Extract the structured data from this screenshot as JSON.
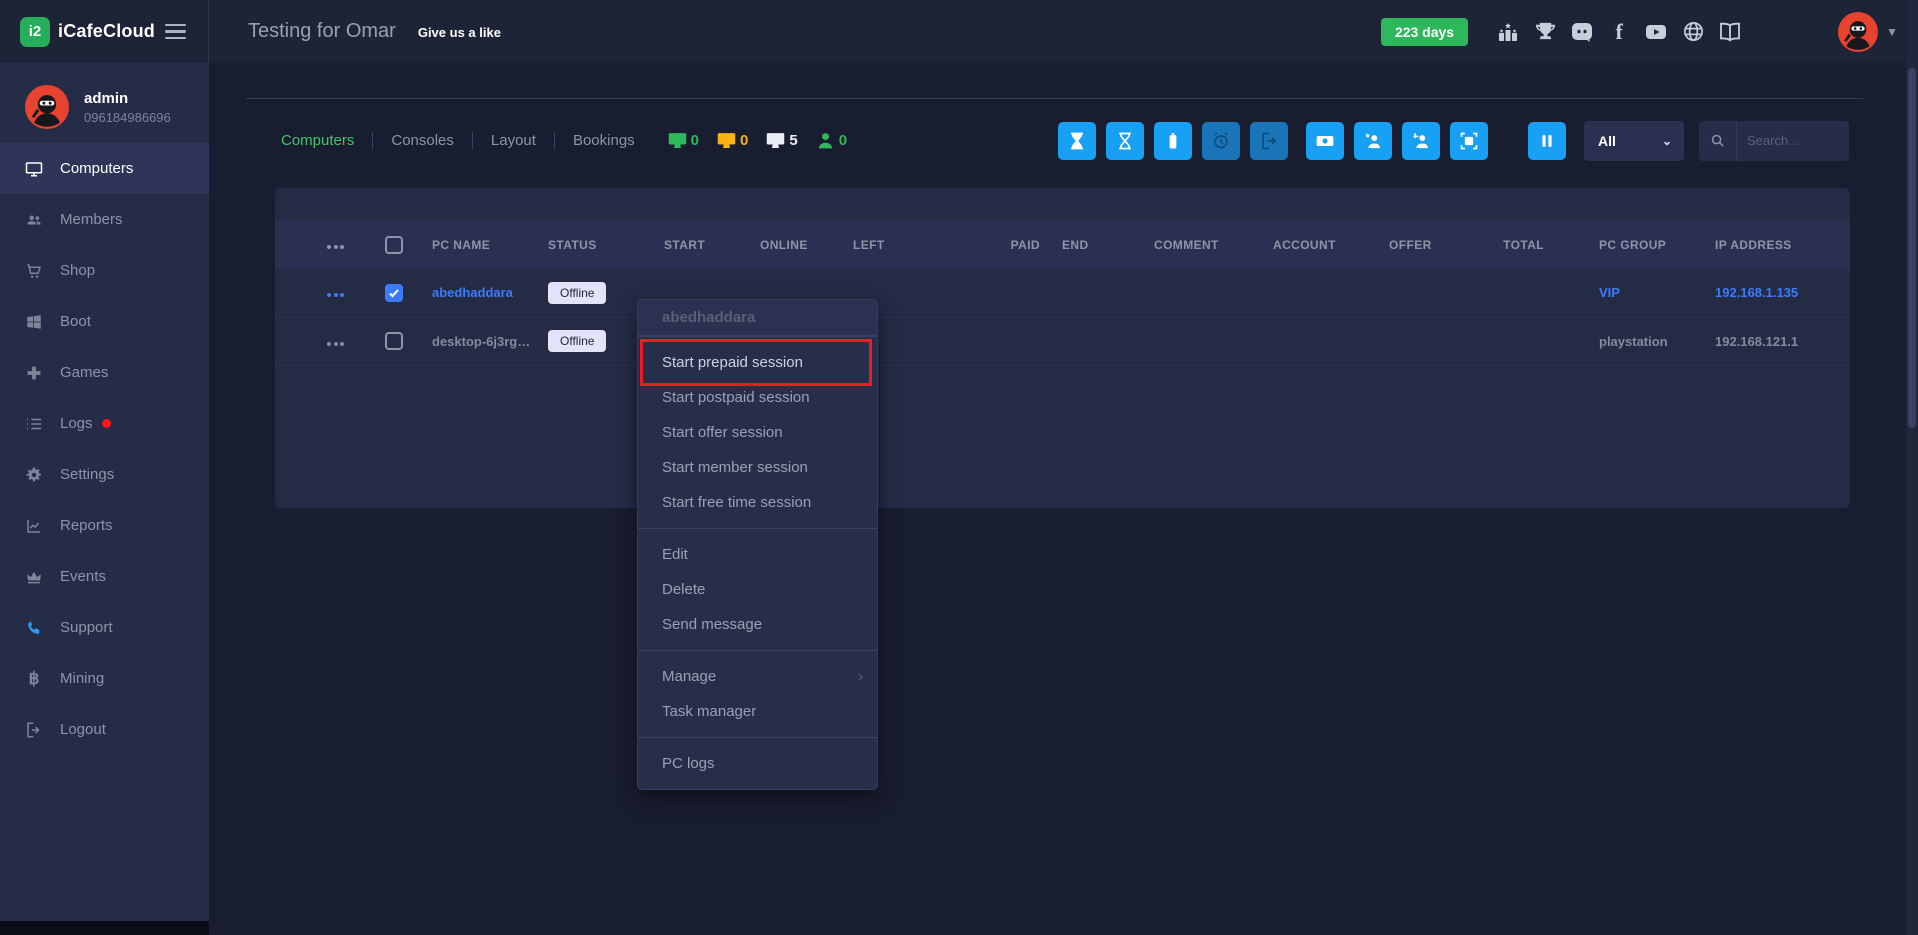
{
  "brand": {
    "name": "iCafeCloud"
  },
  "topbar": {
    "cafe_name": "Testing for Omar",
    "like_label": "Give us a like",
    "days_badge": "223 days"
  },
  "sidebar": {
    "user": {
      "name": "admin",
      "phone": "096184986696"
    },
    "items": [
      {
        "label": "Computers",
        "active": true
      },
      {
        "label": "Members"
      },
      {
        "label": "Shop"
      },
      {
        "label": "Boot"
      },
      {
        "label": "Games"
      },
      {
        "label": "Logs",
        "has_alert_dot": true
      },
      {
        "label": "Settings"
      },
      {
        "label": "Reports"
      },
      {
        "label": "Events"
      },
      {
        "label": "Support"
      },
      {
        "label": "Mining"
      },
      {
        "label": "Logout"
      }
    ]
  },
  "toolbar": {
    "tabs": [
      {
        "label": "Computers",
        "active": true
      },
      {
        "label": "Consoles",
        "active": false
      },
      {
        "label": "Layout",
        "active": false
      },
      {
        "label": "Bookings",
        "active": false
      }
    ],
    "counters": [
      {
        "name": "pcs-in-use",
        "value": "0",
        "color": "#2eb85c"
      },
      {
        "name": "pcs-warning",
        "value": "0",
        "color": "#f9b115"
      },
      {
        "name": "pcs-total",
        "value": "5",
        "color": "#e9edf5"
      },
      {
        "name": "members-online",
        "value": "0",
        "color": "#2eb85c"
      }
    ],
    "filter_value": "All",
    "search_placeholder": "Search..."
  },
  "table": {
    "columns": [
      "PC NAME",
      "STATUS",
      "START",
      "ONLINE",
      "LEFT",
      "PAID",
      "END",
      "COMMENT",
      "ACCOUNT",
      "OFFER",
      "TOTAL",
      "PC GROUP",
      "IP ADDRESS"
    ],
    "rows": [
      {
        "pc_name": "abedhaddara",
        "status": "Offline",
        "pc_group": "VIP",
        "ip_address": "192.168.1.135",
        "checked": true
      },
      {
        "pc_name": "desktop-6j3rg…",
        "status": "Offline",
        "pc_group": "playstation",
        "ip_address": "192.168.121.1",
        "checked": false
      }
    ]
  },
  "context_menu": {
    "title": "abedhaddara",
    "groups": [
      {
        "items": [
          {
            "label": "Start prepaid session",
            "highlighted": true
          },
          {
            "label": "Start postpaid session"
          },
          {
            "label": "Start offer session"
          },
          {
            "label": "Start member session"
          },
          {
            "label": "Start free time session"
          }
        ]
      },
      {
        "items": [
          {
            "label": "Edit"
          },
          {
            "label": "Delete"
          },
          {
            "label": "Send message"
          }
        ]
      },
      {
        "items": [
          {
            "label": "Manage",
            "has_submenu": true
          },
          {
            "label": "Task manager"
          }
        ]
      },
      {
        "items": [
          {
            "label": "PC logs"
          }
        ]
      }
    ]
  },
  "colors": {
    "green_accent": "#2eb85c",
    "tab_active_green": "#41c56d",
    "button_blue": "#18a0f4",
    "button_blue_dark": "#1a74b8",
    "link_blue": "#3d7bfd",
    "warning_orange": "#f9b115",
    "highlight_red": "#ee1b24"
  }
}
